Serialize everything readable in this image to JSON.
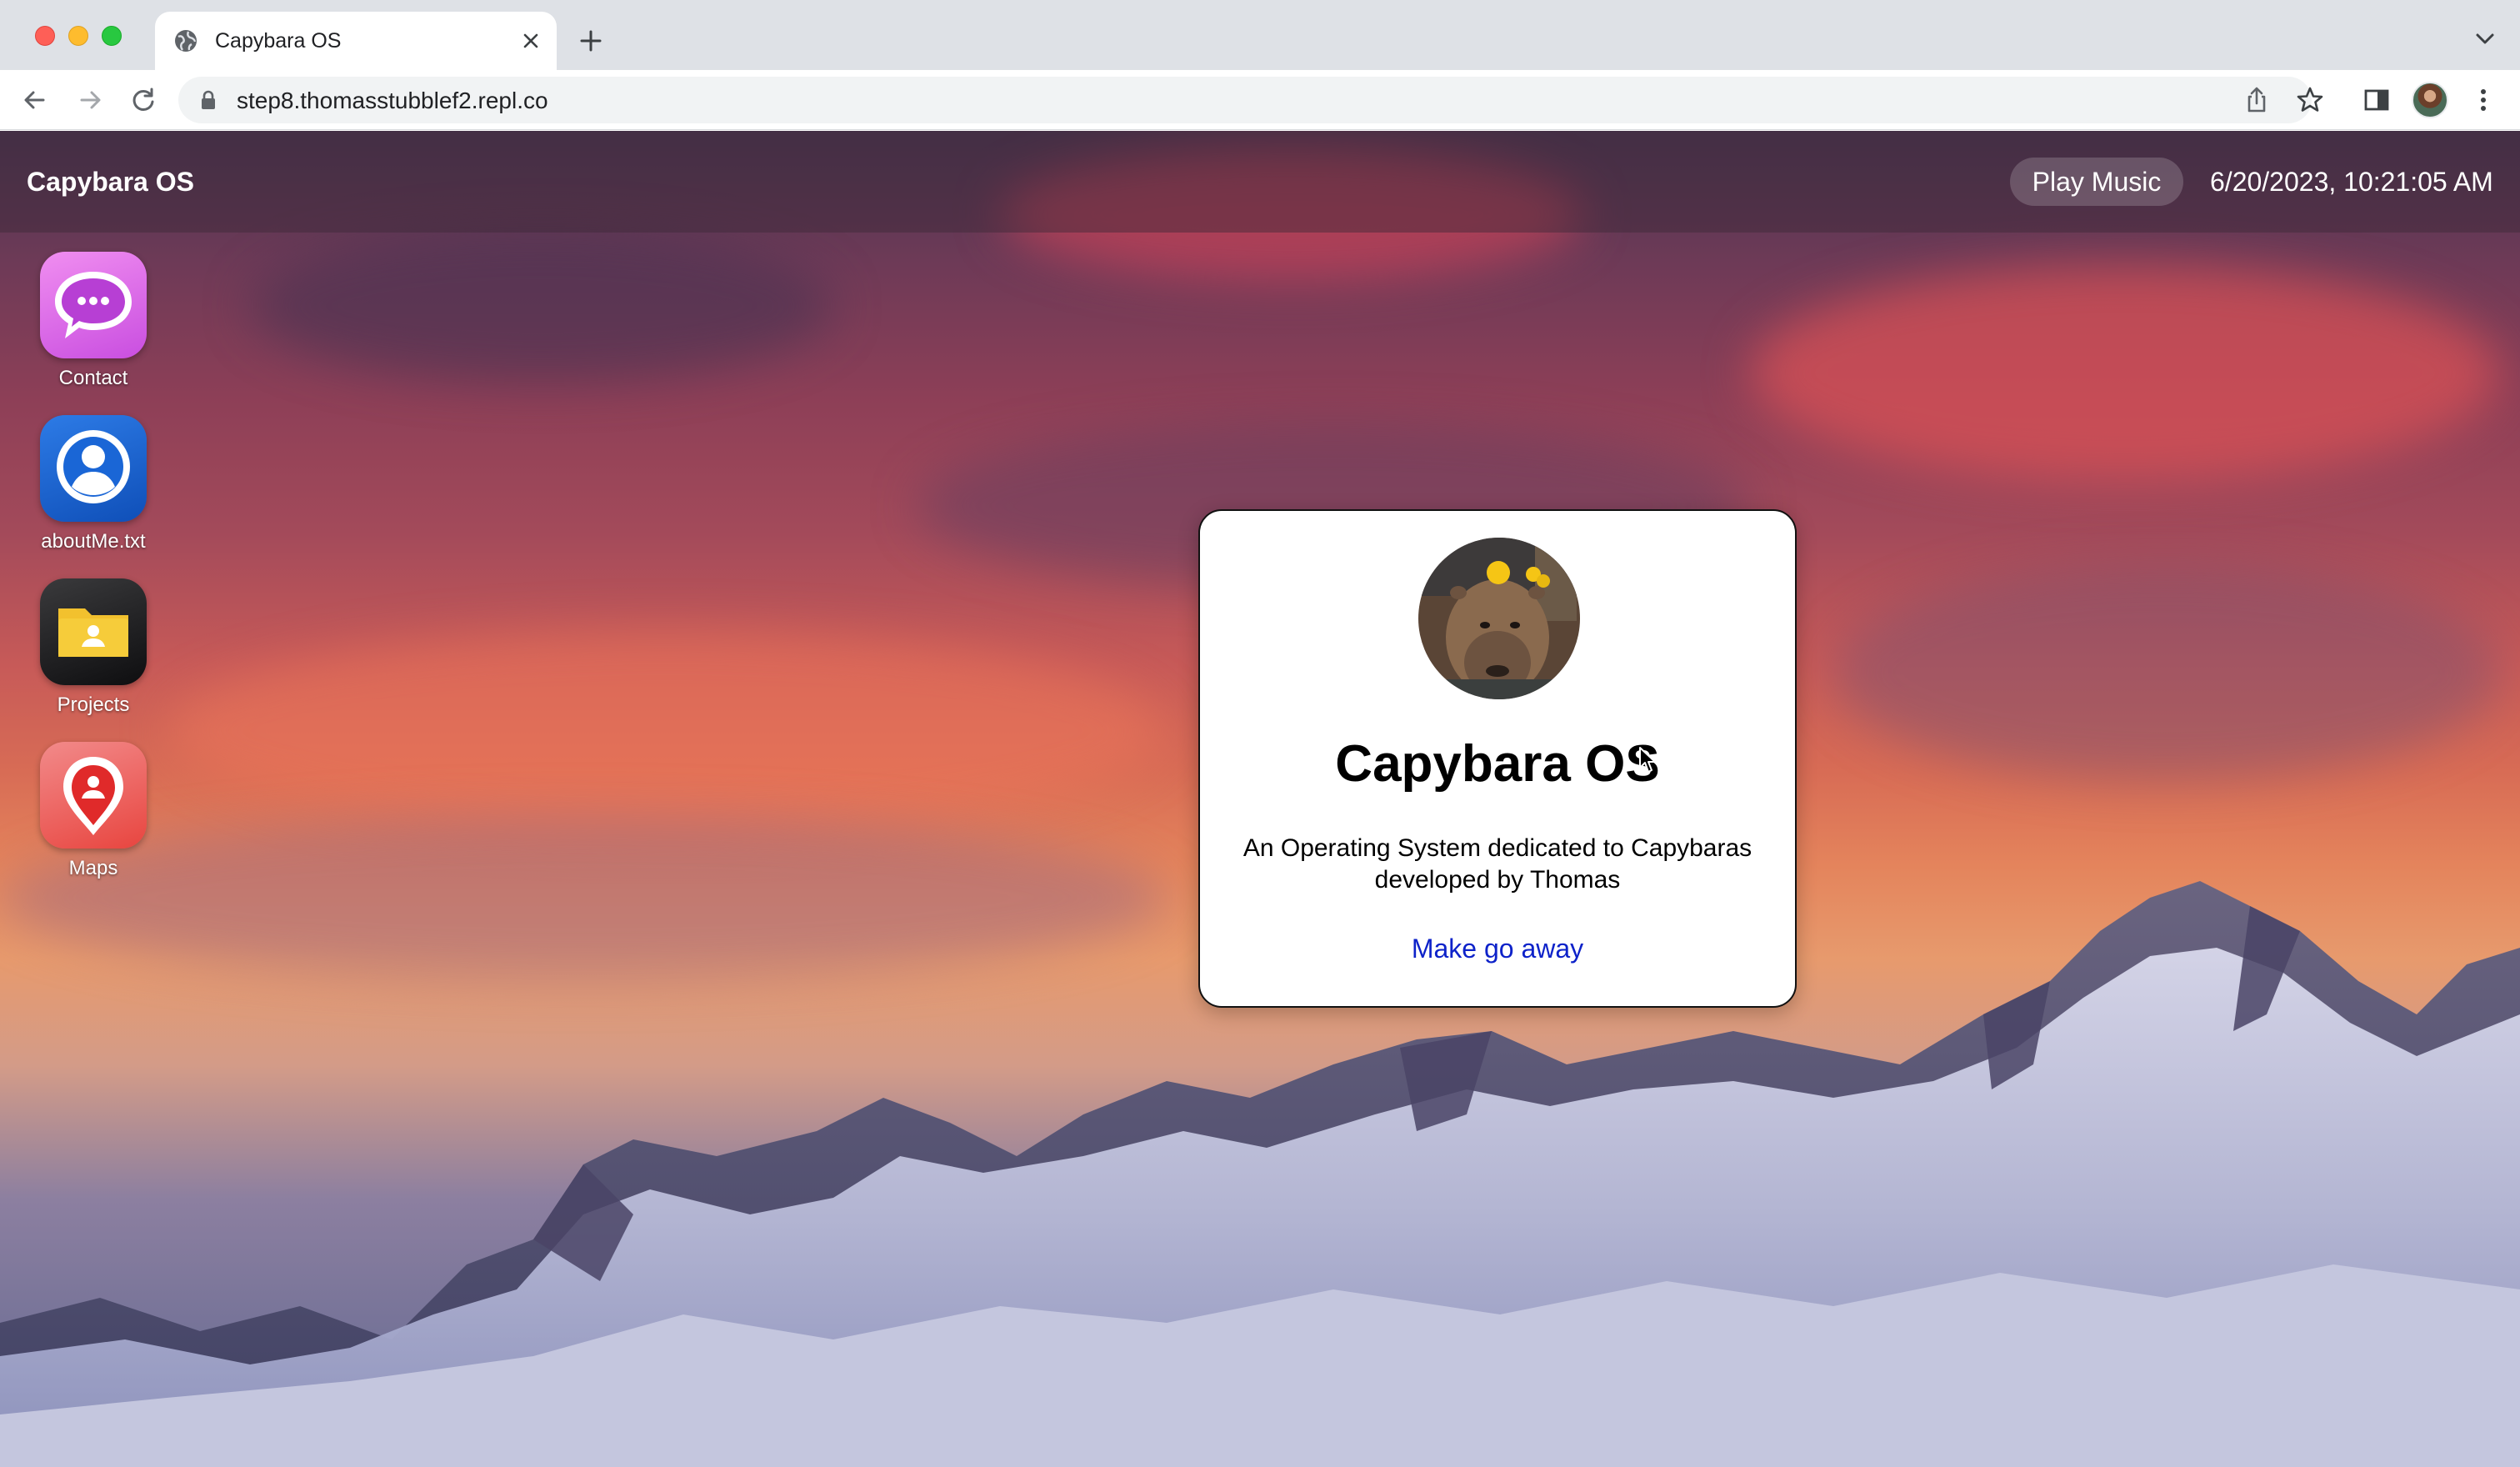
{
  "browser": {
    "tab": {
      "title": "Capybara OS",
      "favicon": "globe-icon"
    },
    "url": "step8.thomasstubblef2.repl.co",
    "icons": [
      "back-icon",
      "forward-icon",
      "reload-icon",
      "lock-icon",
      "share-icon",
      "bookmark-star-icon",
      "side-panel-icon",
      "profile-avatar",
      "kebab-menu-icon",
      "new-tab-icon",
      "tab-search-icon"
    ]
  },
  "menubar": {
    "brand": "Capybara OS",
    "play_music": "Play Music",
    "datetime": "6/20/2023, 10:21:05 AM"
  },
  "desktop": {
    "apps": [
      {
        "label": "Contact",
        "icon": "chat-bubble-icon",
        "color": "#d65ce0"
      },
      {
        "label": "aboutMe.txt",
        "icon": "user-profile-icon",
        "color": "#1a66d6"
      },
      {
        "label": "Projects",
        "icon": "folder-icon",
        "color": "#1c1c1e"
      },
      {
        "label": "Maps",
        "icon": "map-pin-icon",
        "color": "#e8453f"
      }
    ]
  },
  "dialog": {
    "title": "Capybara OS",
    "description": "An Operating System dedicated to Capybaras developed by Thomas",
    "link": "Make go away",
    "avatar": "capybara-avatar"
  },
  "colors": {
    "link": "#0d22c9",
    "tabstrip": "#dee1e6",
    "omnibox": "#f1f3f4"
  }
}
